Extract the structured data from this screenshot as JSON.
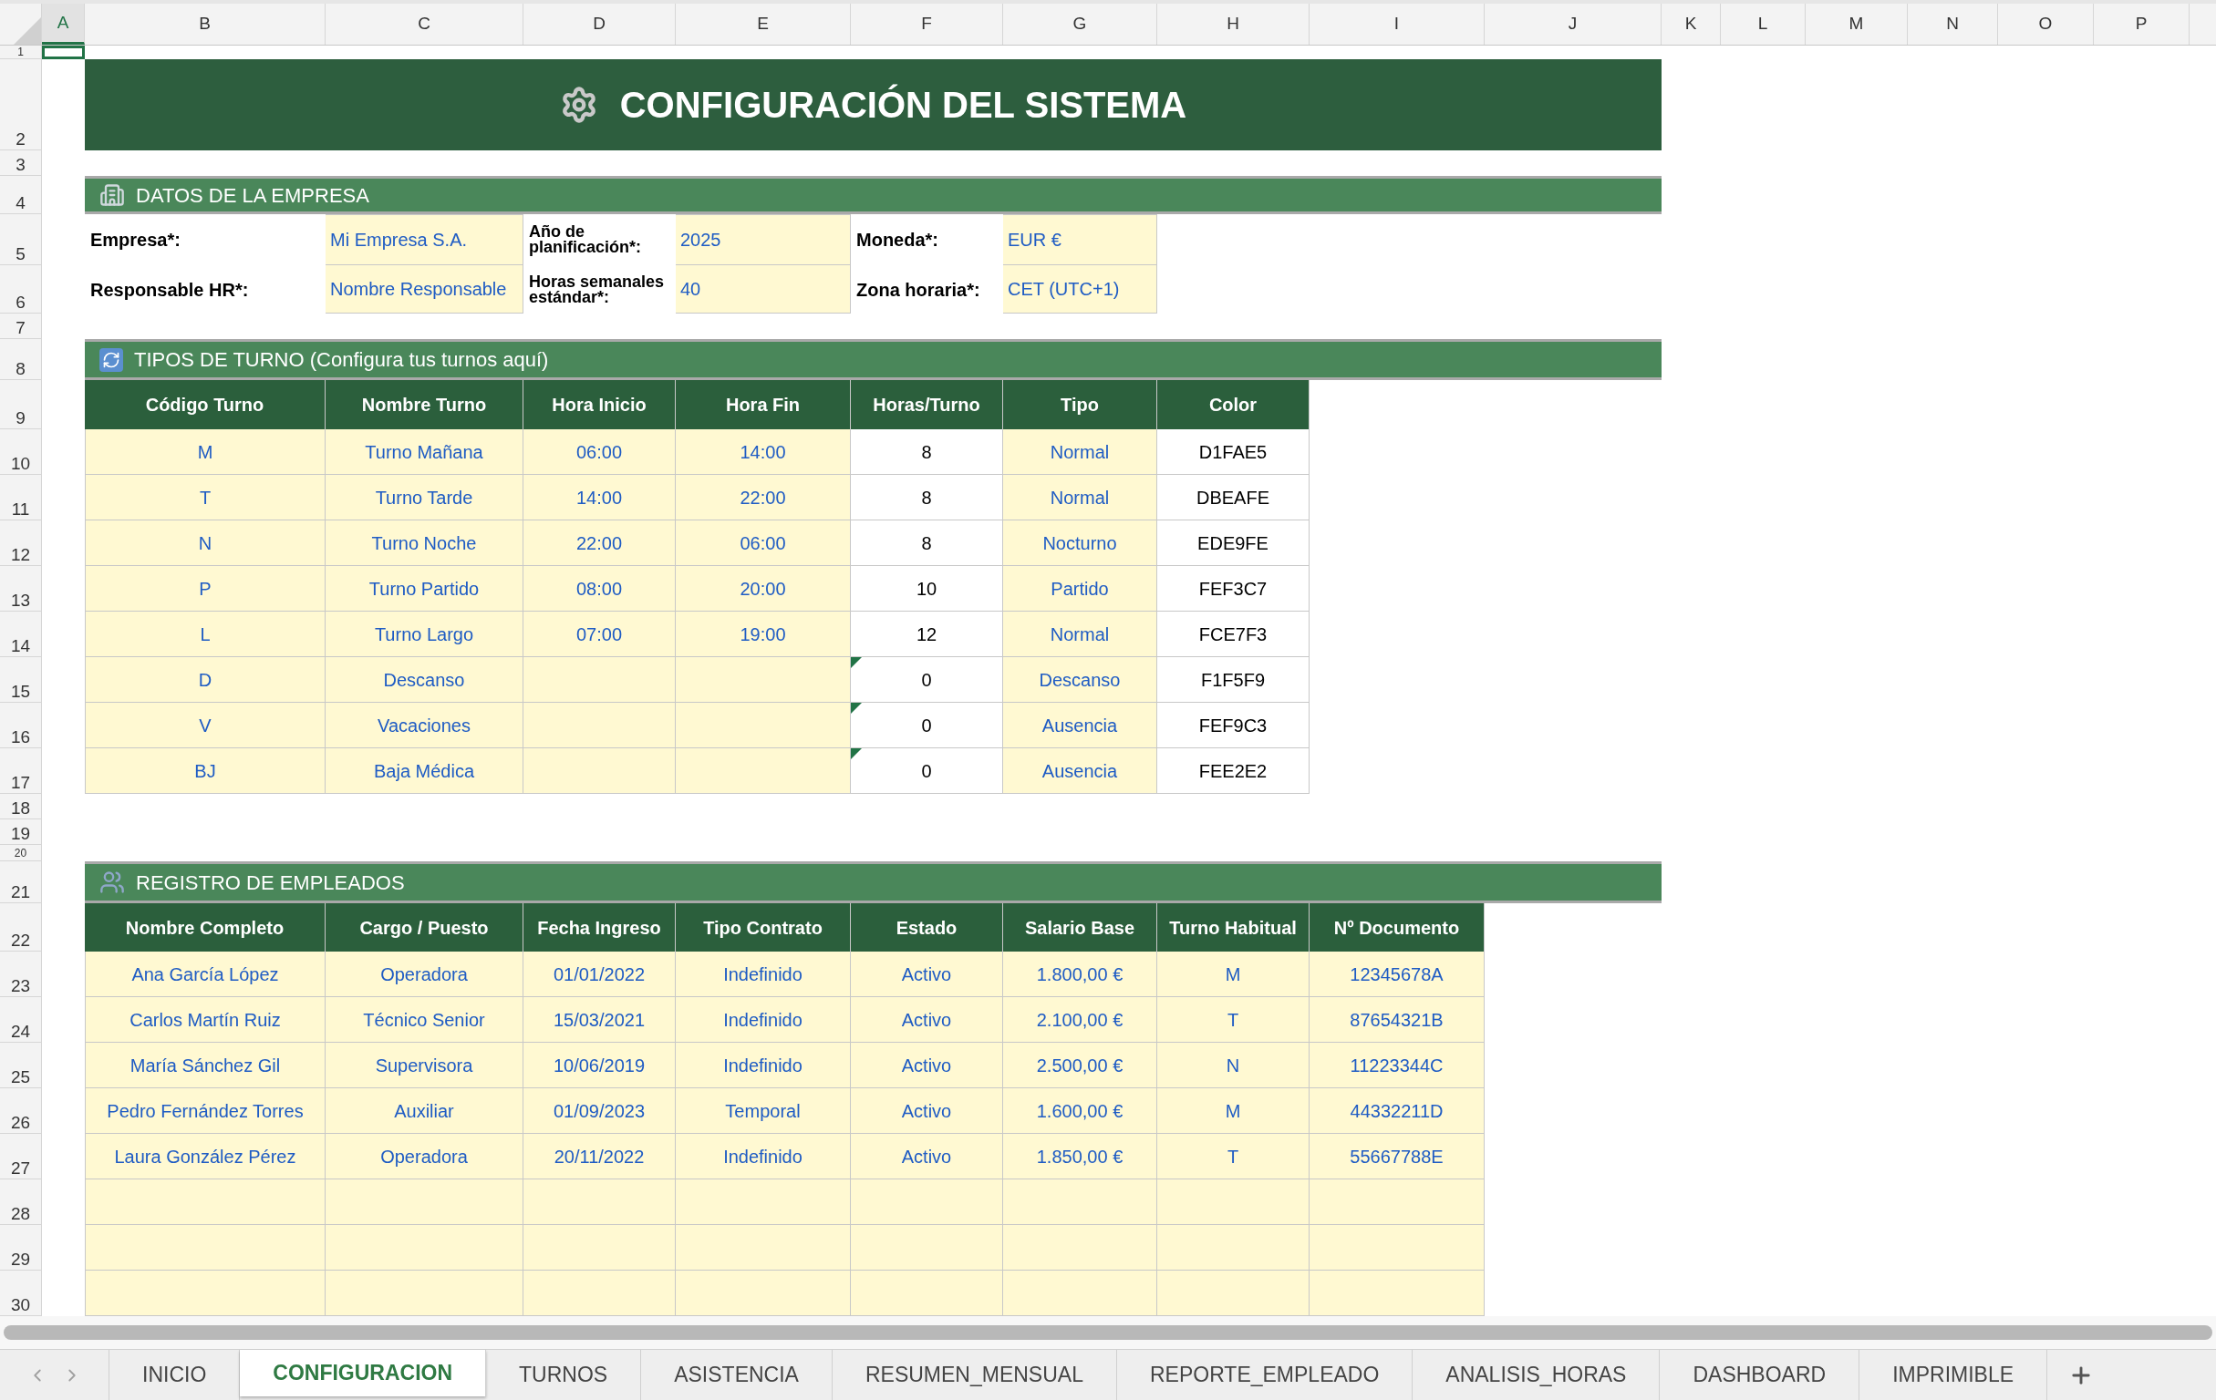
{
  "column_headers": [
    {
      "label": "A",
      "selected": true
    },
    {
      "label": "B",
      "selected": false
    },
    {
      "label": "C",
      "selected": false
    },
    {
      "label": "D",
      "selected": false
    },
    {
      "label": "E",
      "selected": false
    },
    {
      "label": "F",
      "selected": false
    },
    {
      "label": "G",
      "selected": false
    },
    {
      "label": "H",
      "selected": false
    },
    {
      "label": "I",
      "selected": false
    },
    {
      "label": "J",
      "selected": false
    },
    {
      "label": "K",
      "selected": false
    },
    {
      "label": "L",
      "selected": false
    },
    {
      "label": "M",
      "selected": false
    },
    {
      "label": "N",
      "selected": false
    },
    {
      "label": "O",
      "selected": false
    },
    {
      "label": "P",
      "selected": false
    }
  ],
  "row_numbers": [
    "1",
    "2",
    "3",
    "4",
    "5",
    "6",
    "7",
    "8",
    "9",
    "10",
    "11",
    "12",
    "13",
    "14",
    "15",
    "16",
    "17",
    "18",
    "19",
    "20",
    "21",
    "22",
    "23",
    "24",
    "25",
    "26",
    "27",
    "28",
    "29",
    "30"
  ],
  "title": "CONFIGURACIÓN DEL SISTEMA",
  "company": {
    "title": "DATOS DE LA EMPRESA",
    "rows": [
      [
        {
          "label": "Empresa*:",
          "value": "Mi Empresa S.A."
        },
        {
          "label": "Año de planificación*:",
          "value": "2025"
        },
        {
          "label": "Moneda*:",
          "value": "EUR €"
        }
      ],
      [
        {
          "label": "Responsable HR*:",
          "value": "Nombre Responsable"
        },
        {
          "label": "Horas semanales estándar*:",
          "value": "40"
        },
        {
          "label": "Zona horaria*:",
          "value": "CET (UTC+1)"
        }
      ]
    ]
  },
  "shift_table": {
    "title": "TIPOS DE TURNO (Configura tus turnos aquí)",
    "columns": [
      "Código Turno",
      "Nombre Turno",
      "Hora Inicio",
      "Hora Fin",
      "Horas/Turno",
      "Tipo",
      "Color"
    ],
    "rows": [
      {
        "cells": [
          "M",
          "Turno Mañana",
          "06:00",
          "14:00",
          "8",
          "Normal",
          "D1FAE5"
        ],
        "note": false
      },
      {
        "cells": [
          "T",
          "Turno Tarde",
          "14:00",
          "22:00",
          "8",
          "Normal",
          "DBEAFE"
        ],
        "note": false
      },
      {
        "cells": [
          "N",
          "Turno Noche",
          "22:00",
          "06:00",
          "8",
          "Nocturno",
          "EDE9FE"
        ],
        "note": false
      },
      {
        "cells": [
          "P",
          "Turno Partido",
          "08:00",
          "20:00",
          "10",
          "Partido",
          "FEF3C7"
        ],
        "note": false
      },
      {
        "cells": [
          "L",
          "Turno Largo",
          "07:00",
          "19:00",
          "12",
          "Normal",
          "FCE7F3"
        ],
        "note": false
      },
      {
        "cells": [
          "D",
          "Descanso",
          "",
          "",
          "0",
          "Descanso",
          "F1F5F9"
        ],
        "note": true
      },
      {
        "cells": [
          "V",
          "Vacaciones",
          "",
          "",
          "0",
          "Ausencia",
          "FEF9C3"
        ],
        "note": true
      },
      {
        "cells": [
          "BJ",
          "Baja Médica",
          "",
          "",
          "0",
          "Ausencia",
          "FEE2E2"
        ],
        "note": true
      }
    ]
  },
  "employee_table": {
    "title": "REGISTRO DE EMPLEADOS",
    "columns": [
      "Nombre Completo",
      "Cargo / Puesto",
      "Fecha Ingreso",
      "Tipo Contrato",
      "Estado",
      "Salario Base",
      "Turno Habitual",
      "Nº Documento"
    ],
    "rows": [
      [
        "Ana García López",
        "Operadora",
        "01/01/2022",
        "Indefinido",
        "Activo",
        "1.800,00 €",
        "M",
        "12345678A"
      ],
      [
        "Carlos Martín Ruiz",
        "Técnico Senior",
        "15/03/2021",
        "Indefinido",
        "Activo",
        "2.100,00 €",
        "T",
        "87654321B"
      ],
      [
        "María Sánchez Gil",
        "Supervisora",
        "10/06/2019",
        "Indefinido",
        "Activo",
        "2.500,00 €",
        "N",
        "11223344C"
      ],
      [
        "Pedro Fernández Torres",
        "Auxiliar",
        "01/09/2023",
        "Temporal",
        "Activo",
        "1.600,00 €",
        "M",
        "44332211D"
      ],
      [
        "Laura González Pérez",
        "Operadora",
        "20/11/2022",
        "Indefinido",
        "Activo",
        "1.850,00 €",
        "T",
        "55667788E"
      ]
    ]
  },
  "sheet_tabs": [
    {
      "label": "INICIO",
      "selected": false
    },
    {
      "label": "CONFIGURACION",
      "selected": true
    },
    {
      "label": "TURNOS",
      "selected": false
    },
    {
      "label": "ASISTENCIA",
      "selected": false
    },
    {
      "label": "RESUMEN_MENSUAL",
      "selected": false
    },
    {
      "label": "REPORTE_EMPLEADO",
      "selected": false
    },
    {
      "label": "ANALISIS_HORAS",
      "selected": false
    },
    {
      "label": "DASHBOARD",
      "selected": false
    },
    {
      "label": "IMPRIMIBLE",
      "selected": false
    }
  ]
}
